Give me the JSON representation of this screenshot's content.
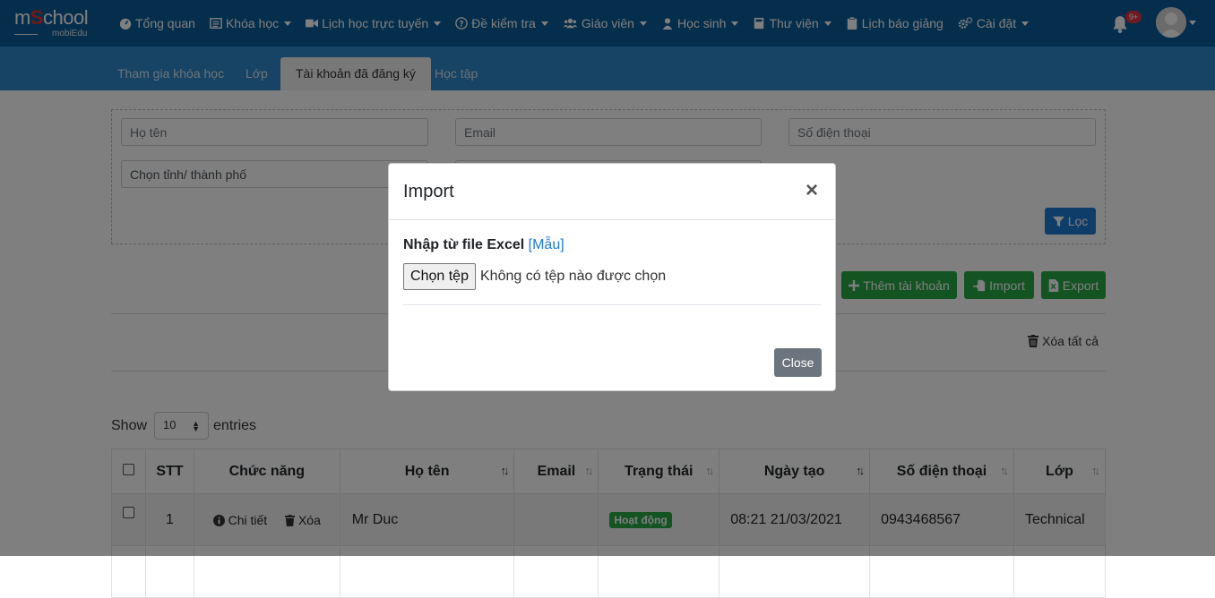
{
  "logo": {
    "brand_prefix": "m",
    "brand_s": "S",
    "brand_suffix": "chool",
    "sub": "mobiEdu"
  },
  "nav": {
    "items": [
      {
        "label": "Tổng quan",
        "icon": "dashboard-icon",
        "has_caret": false
      },
      {
        "label": "Khóa học",
        "icon": "list-icon",
        "has_caret": true
      },
      {
        "label": "Lịch học trực tuyến",
        "icon": "video-camera-icon",
        "has_caret": true
      },
      {
        "label": "Đề kiểm tra",
        "icon": "question-circle-icon",
        "has_caret": true
      },
      {
        "label": "Giáo viên",
        "icon": "users-icon",
        "has_caret": true
      },
      {
        "label": "Học sinh",
        "icon": "user-icon",
        "has_caret": true
      },
      {
        "label": "Thư viện",
        "icon": "book-icon",
        "has_caret": true
      },
      {
        "label": "Lịch báo giảng",
        "icon": "clipboard-icon",
        "has_caret": false
      },
      {
        "label": "Cài đặt",
        "icon": "cogs-icon",
        "has_caret": true
      }
    ],
    "notification_count": "9+"
  },
  "tabs": [
    {
      "label": "Tham gia khóa học",
      "active": false
    },
    {
      "label": "Lớp",
      "active": false
    },
    {
      "label": "Tài khoản đã đăng ký",
      "active": true
    },
    {
      "label": "Học tập",
      "active": false
    }
  ],
  "filters": {
    "name_placeholder": "Họ tên",
    "email_placeholder": "Email",
    "phone_placeholder": "Số điện thoại",
    "province_placeholder": "Chọn tỉnh/ thành phố",
    "filter_button": "Lọc"
  },
  "actions": {
    "add_account": "Thêm tài khoản",
    "import": "Import",
    "export": "Export",
    "delete_all": "Xóa tất cả"
  },
  "length_menu": {
    "show": "Show",
    "value": "10",
    "entries": "entries"
  },
  "table": {
    "headers": [
      "STT",
      "Chức năng",
      "Họ tên",
      "Email",
      "Trạng thái",
      "Ngày tạo",
      "Số điện thoại",
      "Lớp"
    ],
    "rows": [
      {
        "stt": "1",
        "detail": "Chi tiết",
        "delete": "Xóa",
        "name": "Mr Duc",
        "email": "",
        "status": "Hoạt động",
        "created": "08:21 21/03/2021",
        "phone": "0943468567",
        "class": "Technical"
      }
    ]
  },
  "modal": {
    "title": "Import",
    "close_symbol": "×",
    "label": "Nhập từ file Excel",
    "template_link": "[Mẫu]",
    "file_button": "Chọn tệp",
    "file_status": "Không có tệp nào được chọn",
    "close_button": "Close"
  },
  "colors": {
    "nav_bg": "#0b5d9a",
    "tabbar_bg": "#2e86c8",
    "primary": "#1e7bd4",
    "success": "#28a745",
    "danger": "#dc3545",
    "secondary": "#6c757d"
  }
}
